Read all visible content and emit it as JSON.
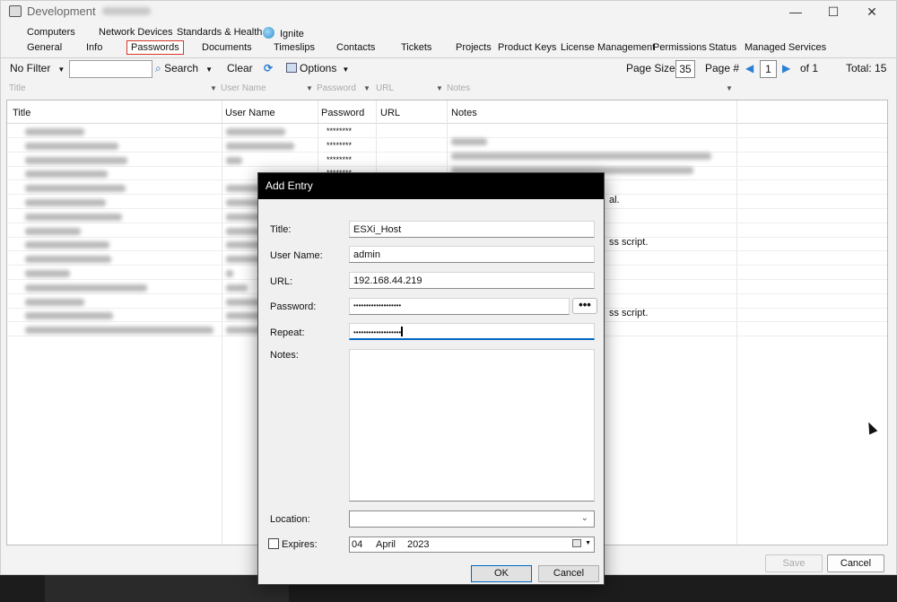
{
  "window": {
    "title": "Development",
    "minimize_glyph": "—",
    "maximize_glyph": "☐",
    "close_glyph": "✕"
  },
  "tabs_row1": [
    "Computers",
    "Network Devices",
    "Standards & Health",
    "Ignite"
  ],
  "tabs_row2": [
    "General",
    "Info",
    "Passwords",
    "Documents",
    "Timeslips",
    "Contacts",
    "Tickets",
    "Projects",
    "Product Keys",
    "License Management",
    "Permissions",
    "Status",
    "Managed Services"
  ],
  "active_tab": "Passwords",
  "toolbar": {
    "filter_label": "No Filter",
    "search_label": "Search",
    "clear_label": "Clear",
    "options_label": "Options",
    "page_size_label": "Page Size",
    "page_size_value": "35",
    "page_num_label": "Page #",
    "page_num_value": "1",
    "of_label": "of 1",
    "total_label": "Total: 15"
  },
  "filter_row": [
    "Title",
    "User Name",
    "Password",
    "URL",
    "Notes"
  ],
  "grid": {
    "columns": [
      "Title",
      "User Name",
      "Password",
      "URL",
      "Notes"
    ],
    "password_mask": "********",
    "visible_note_fragments": [
      "al.",
      "ss script.",
      "ss script."
    ]
  },
  "footer": {
    "save_label": "Save",
    "cancel_label": "Cancel"
  },
  "dialog": {
    "title": "Add Entry",
    "title_label": "Title:",
    "title_value": "ESXi_Host",
    "username_label": "User Name:",
    "username_value": "admin",
    "url_label": "URL:",
    "url_value": "192.168.44.219",
    "password_label": "Password:",
    "password_value": "•••••••••••••••••••",
    "dots_label": "•••",
    "repeat_label": "Repeat:",
    "repeat_value": "•••••••••••••••••••",
    "notes_label": "Notes:",
    "location_label": "Location:",
    "expires_label": "Expires:",
    "expires_day": "04",
    "expires_month": "April",
    "expires_year": "2023",
    "ok_label": "OK",
    "cancel_label": "Cancel"
  }
}
